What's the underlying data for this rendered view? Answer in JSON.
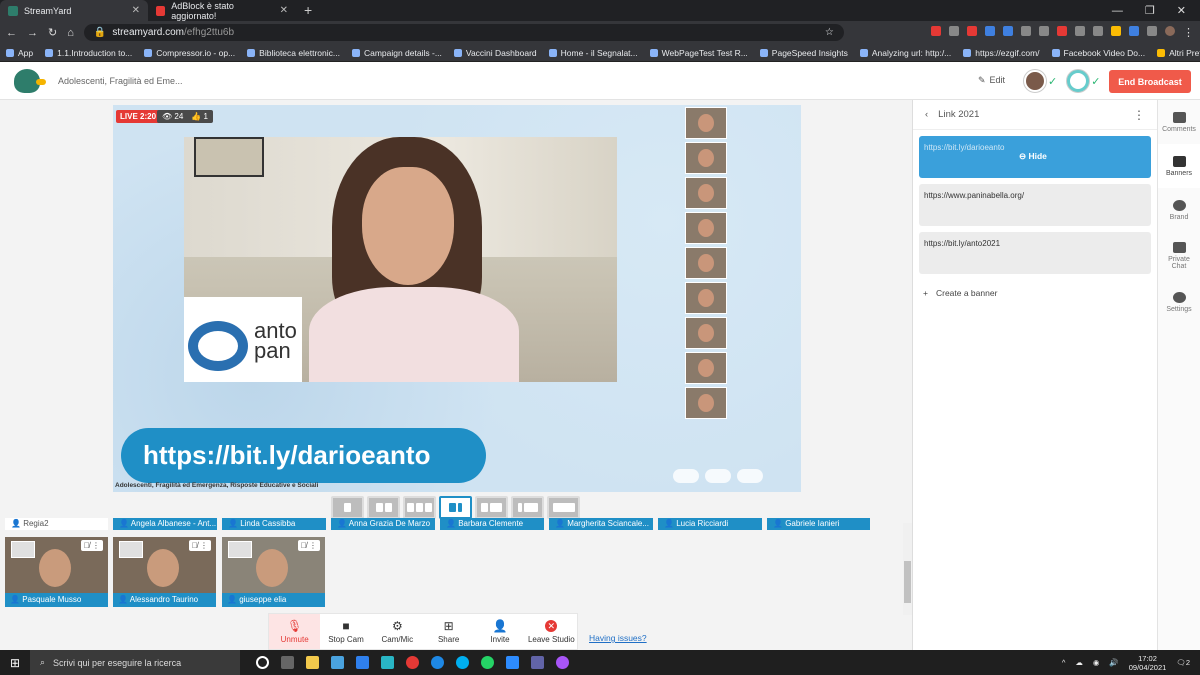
{
  "browser": {
    "tabs": [
      {
        "label": "StreamYard",
        "active": true,
        "icon_color": "#2e7d6b"
      },
      {
        "label": "AdBlock è stato aggiornato!",
        "active": false,
        "icon_color": "#e53935"
      }
    ],
    "url_host": "streamyard.com",
    "url_path": "/efhg2ttu6b",
    "bookmarks": [
      "App",
      "1.1.Introduction to...",
      "Compressor.io - op...",
      "Biblioteca elettronic...",
      "Campaign details -...",
      "Vaccini Dashboard",
      "Home - il Segnalat...",
      "WebPageTest Test R...",
      "PageSpeed Insights",
      "Analyzing url: http:/...",
      "https://ezgif.com/",
      "Facebook Video Do..."
    ],
    "bookmarks_other": "Altri Preferiti"
  },
  "header": {
    "broadcast_title": "Adolescenti, Fragilità ed Eme...",
    "edit_label": "Edit",
    "end_label": "End Broadcast"
  },
  "stage": {
    "live_label": "LIVE 2:20",
    "viewers": "24",
    "likes": "1",
    "banner_text": "https://bit.ly/darioeanto",
    "caption": "Adolescenti, Fragilità ed Emergenza, Risposte Educative e Sociali",
    "logo_text": "anto pan"
  },
  "participants": {
    "row_names": [
      "Regia2",
      "Angela Albanese - Ant...",
      "Linda Cassibba",
      "Anna Grazia De Marzo",
      "Barbara Clemente",
      "Margherita Sciancale...",
      "Lucia Ricciardi",
      "Gabriele Ianieri"
    ],
    "tiles": [
      "Pasquale Musso",
      "Alessandro Taurino",
      "giuseppe elia"
    ]
  },
  "controls": {
    "unmute": "Unmute",
    "stop_cam": "Stop Cam",
    "cam_mic": "Cam/Mic",
    "share": "Share",
    "invite": "Invite",
    "leave": "Leave Studio",
    "issues": "Having issues?"
  },
  "panel": {
    "title": "Link 2021",
    "banners": [
      {
        "text": "https://bit.ly/darioeanto",
        "active": true
      },
      {
        "text": "https://www.paninabella.org/",
        "active": false
      },
      {
        "text": "https://bit.ly/anto2021",
        "active": false
      }
    ],
    "hide_label": "Hide",
    "create_label": "Create a banner"
  },
  "rail": [
    "Comments",
    "Banners",
    "Brand",
    "Private Chat",
    "Settings"
  ],
  "taskbar": {
    "search_placeholder": "Scrivi qui per eseguire la ricerca",
    "time": "17:02",
    "date": "09/04/2021",
    "notif_count": "2"
  },
  "colors": {
    "accent": "#1f8fc6",
    "end": "#f05a4a",
    "live": "#e53935"
  }
}
